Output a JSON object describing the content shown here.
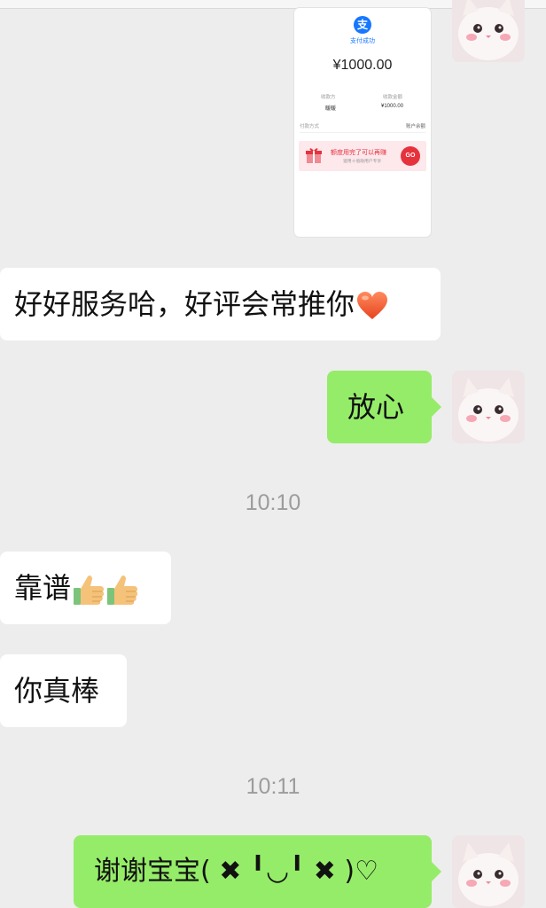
{
  "receipt": {
    "logo_glyph": "支",
    "status": "支付成功",
    "amount": "¥1000.00",
    "payee_label": "收款方",
    "payee_value": "暖暖",
    "received_label": "收款金额",
    "received_value": "¥1000.00",
    "payment_method_label": "付款方式",
    "payment_method_value": "账户余额",
    "banner_title": "额度用完了可以再赚",
    "banner_subtitle": "速用十倍助用户专享",
    "banner_button": "GO"
  },
  "messages": [
    {
      "side": "left",
      "text": "好好服务哈，好评会常推你",
      "emoji": "heart-icon"
    },
    {
      "side": "right",
      "text": "放心"
    },
    {
      "time": "10:10"
    },
    {
      "side": "left",
      "text": "靠谱",
      "emoji": "thumbs-up-icon x2"
    },
    {
      "side": "left",
      "text": "你真棒"
    },
    {
      "time": "10:11"
    },
    {
      "side": "right",
      "text": "谢谢宝宝( ✖ ╹◡╹ ✖ )♡"
    }
  ],
  "colors": {
    "background": "#ededed",
    "incoming_bubble": "#ffffff",
    "outgoing_bubble": "#95ec69",
    "timestamp": "#9c9c9c",
    "alipay_blue": "#1677ff",
    "banner_red": "#e6323c"
  }
}
